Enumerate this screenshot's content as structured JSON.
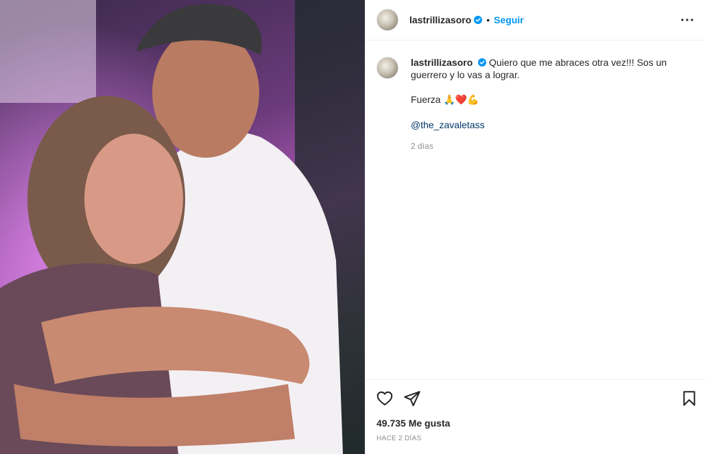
{
  "post": {
    "image_alt": "Foto de dos personas abrazándose",
    "colors": {
      "accent": "#0095f6",
      "mention": "#00376b",
      "muted": "#8e8e8e",
      "text": "#262626"
    }
  },
  "header": {
    "username": "lastrillizasoro",
    "separator": "•",
    "follow_label": "Seguir",
    "verified_icon": "verified-badge-icon",
    "more_icon": "more-options-icon"
  },
  "caption": {
    "username": "lastrillizasoro",
    "text": "Quiero que me abraces otra vez!!! Sos un guerrero y lo vas a lograr.",
    "line2_word": "Fuerza",
    "line2_emoji": "🙏❤️💪",
    "mention": "@the_zavaletass",
    "time": "2 días"
  },
  "actions": {
    "like_icon": "heart-icon",
    "share_icon": "paper-plane-icon",
    "save_icon": "bookmark-icon"
  },
  "likes": "49.735 Me gusta",
  "posted_ago": "HACE 2 DÍAS"
}
